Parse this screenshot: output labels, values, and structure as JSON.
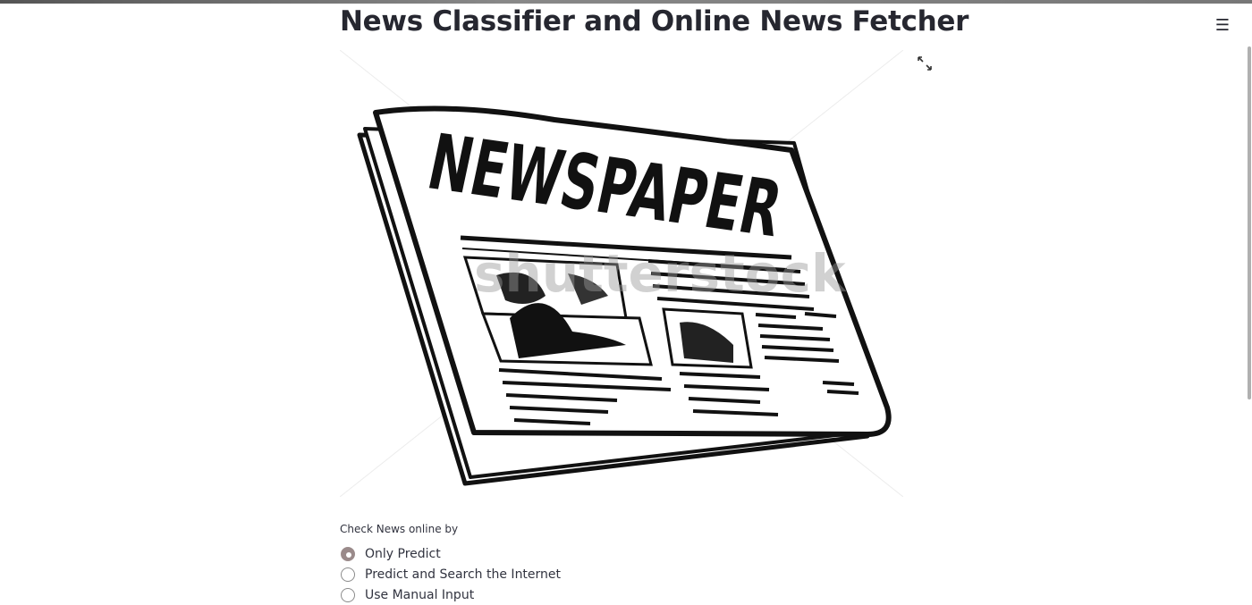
{
  "app": {
    "title": "News Classifier and Online News Fetcher"
  },
  "header": {
    "menu_icon": "hamburger-icon"
  },
  "image": {
    "headline": "NEWSPAPER",
    "watermark": "shutterstock",
    "expand_icon": "fullscreen-expand-icon"
  },
  "radio": {
    "label": "Check News online by",
    "options": [
      {
        "label": "Only Predict",
        "checked": true
      },
      {
        "label": "Predict and Search the Internet",
        "checked": false
      },
      {
        "label": "Use Manual Input",
        "checked": false
      }
    ]
  },
  "colors": {
    "text": "#262730",
    "radio_accent": "#9a8a8a"
  }
}
